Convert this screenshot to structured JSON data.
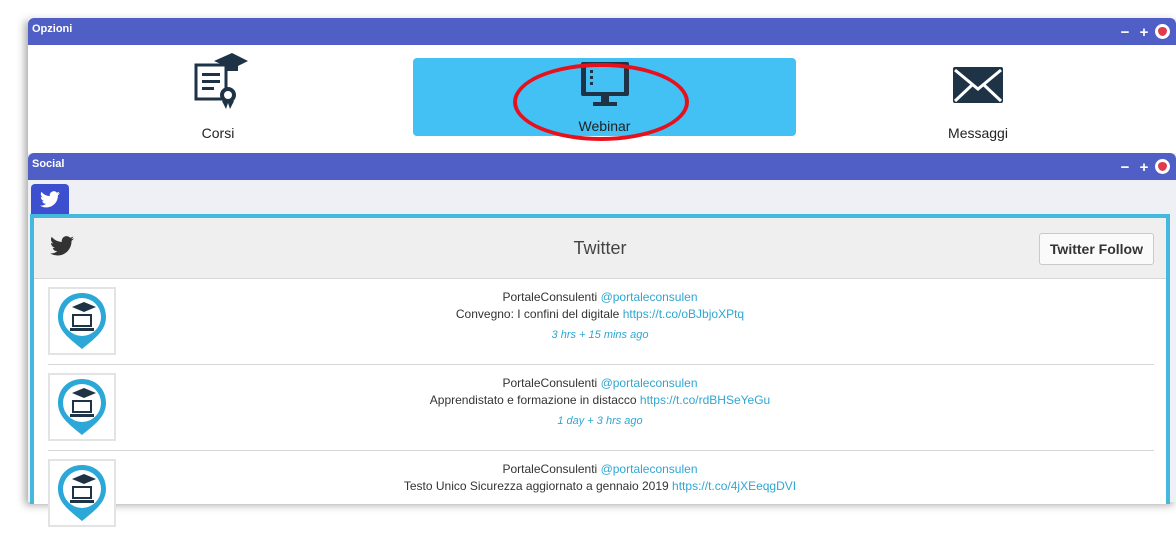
{
  "options_panel": {
    "title": "Opzioni"
  },
  "options": [
    {
      "label": "Corsi",
      "icon": "certificate-icon"
    },
    {
      "label": "Webinar",
      "icon": "monitor-icon",
      "selected": true
    },
    {
      "label": "Messaggi",
      "icon": "envelope-icon"
    }
  ],
  "social_panel": {
    "title": "Social"
  },
  "twitter": {
    "header_title": "Twitter",
    "follow_label": "Twitter Follow",
    "tweets": [
      {
        "author": "PortaleConsulenti",
        "handle": "@portaleconsulen",
        "text": "Convegno: I confini del digitale",
        "link": "https://t.co/oBJbjoXPtq",
        "time": "3 hrs + 15 mins ago"
      },
      {
        "author": "PortaleConsulenti",
        "handle": "@portaleconsulen",
        "text": "Apprendistato e formazione in distacco",
        "link": "https://t.co/rdBHSeYeGu",
        "time": "1 day + 3 hrs ago"
      },
      {
        "author": "PortaleConsulenti",
        "handle": "@portaleconsulen",
        "text": "Testo Unico Sicurezza aggiornato a gennaio 2019",
        "link": "https://t.co/4jXEeqgDVI",
        "time": ""
      }
    ]
  },
  "colors": {
    "header_bar": "#4f5fc6",
    "selected_option": "#43c1f5",
    "highlight_ring": "#e6111c",
    "twitter_border": "#45b9dd",
    "link": "#2fa6d2"
  }
}
